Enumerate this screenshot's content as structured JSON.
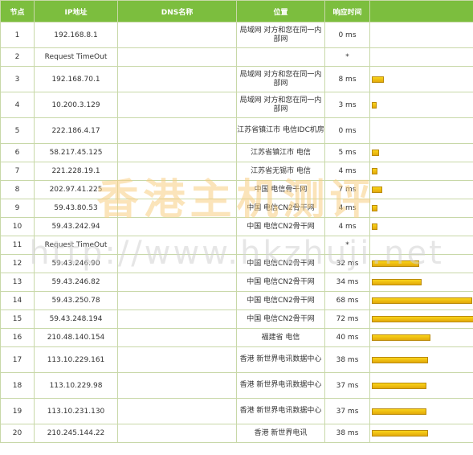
{
  "headers": [
    "节点",
    "IP地址",
    "DNS名称",
    "位置",
    "响应时间",
    ""
  ],
  "colors": {
    "header_bg": "#7cbe3e",
    "header_text": "#ffffff",
    "border": "#c8d8a8",
    "bar": "#f5c518"
  },
  "bar_max_ms": 72,
  "watermark": {
    "line1": "香港主机测评",
    "line2": "http://www.hkzhuji.net"
  },
  "rows": [
    {
      "node": "1",
      "ip": "192.168.8.1",
      "dns": "",
      "location": "局域网 对方和您在同一内部网",
      "time": "0 ms",
      "ms": 0
    },
    {
      "node": "2",
      "ip": "Request TimeOut",
      "dns": "",
      "location": "",
      "time": "*",
      "ms": 0
    },
    {
      "node": "3",
      "ip": "192.168.70.1",
      "dns": "",
      "location": "局域网 对方和您在同一内部网",
      "time": "8 ms",
      "ms": 8
    },
    {
      "node": "4",
      "ip": "10.200.3.129",
      "dns": "",
      "location": "局域网 对方和您在同一内部网",
      "time": "3 ms",
      "ms": 3
    },
    {
      "node": "5",
      "ip": "222.186.4.17",
      "dns": "",
      "location": "江苏省镇江市 电信IDC机房",
      "time": "0 ms",
      "ms": 0
    },
    {
      "node": "6",
      "ip": "58.217.45.125",
      "dns": "",
      "location": "江苏省镇江市 电信",
      "time": "5 ms",
      "ms": 5
    },
    {
      "node": "7",
      "ip": "221.228.19.1",
      "dns": "",
      "location": "江苏省无锡市 电信",
      "time": "4 ms",
      "ms": 4
    },
    {
      "node": "8",
      "ip": "202.97.41.225",
      "dns": "",
      "location": "中国 电信骨干网",
      "time": "7 ms",
      "ms": 7
    },
    {
      "node": "9",
      "ip": "59.43.80.53",
      "dns": "",
      "location": "中国 电信CN2骨干网",
      "time": "4 ms",
      "ms": 4
    },
    {
      "node": "10",
      "ip": "59.43.242.94",
      "dns": "",
      "location": "中国 电信CN2骨干网",
      "time": "4 ms",
      "ms": 4
    },
    {
      "node": "11",
      "ip": "Request TimeOut",
      "dns": "",
      "location": "",
      "time": "*",
      "ms": 0
    },
    {
      "node": "12",
      "ip": "59.43.246.90",
      "dns": "",
      "location": "中国 电信CN2骨干网",
      "time": "32 ms",
      "ms": 32
    },
    {
      "node": "13",
      "ip": "59.43.246.82",
      "dns": "",
      "location": "中国 电信CN2骨干网",
      "time": "34 ms",
      "ms": 34
    },
    {
      "node": "14",
      "ip": "59.43.250.78",
      "dns": "",
      "location": "中国 电信CN2骨干网",
      "time": "68 ms",
      "ms": 68
    },
    {
      "node": "15",
      "ip": "59.43.248.194",
      "dns": "",
      "location": "中国 电信CN2骨干网",
      "time": "72 ms",
      "ms": 72
    },
    {
      "node": "16",
      "ip": "210.48.140.154",
      "dns": "",
      "location": "福建省 电信",
      "time": "40 ms",
      "ms": 40
    },
    {
      "node": "17",
      "ip": "113.10.229.161",
      "dns": "",
      "location": "香港 新世界电讯数据中心",
      "time": "38 ms",
      "ms": 38
    },
    {
      "node": "18",
      "ip": "113.10.229.98",
      "dns": "",
      "location": "香港 新世界电讯数据中心",
      "time": "37 ms",
      "ms": 37
    },
    {
      "node": "19",
      "ip": "113.10.231.130",
      "dns": "",
      "location": "香港 新世界电讯数据中心",
      "time": "37 ms",
      "ms": 37
    },
    {
      "node": "20",
      "ip": "210.245.144.22",
      "dns": "",
      "location": "香港 新世界电讯",
      "time": "38 ms",
      "ms": 38
    }
  ]
}
